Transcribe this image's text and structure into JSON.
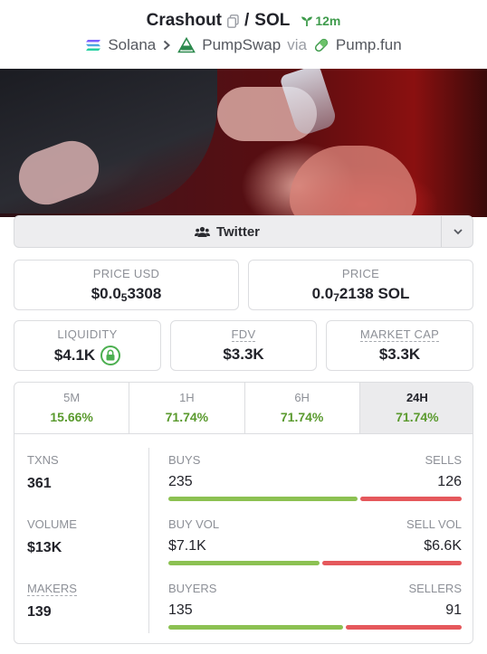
{
  "header": {
    "token": "Crashout",
    "separator": "/",
    "quote": "SOL",
    "age": "12m",
    "chain": "Solana",
    "dex": "PumpSwap",
    "via": "via",
    "launchpad": "Pump.fun"
  },
  "social": {
    "label": "Twitter"
  },
  "price_usd": {
    "label": "PRICE USD",
    "prefix": "$0.0",
    "zeros": "5",
    "rest": "3308"
  },
  "price": {
    "label": "PRICE",
    "prefix": "0.0",
    "zeros": "7",
    "rest": "2138 SOL"
  },
  "liquidity": {
    "label": "LIQUIDITY",
    "value": "$4.1K"
  },
  "fdv": {
    "label": "FDV",
    "value": "$3.3K"
  },
  "market_cap": {
    "label": "MARKET CAP",
    "value": "$3.3K"
  },
  "tabs": [
    {
      "label": "5M",
      "value": "15.66%"
    },
    {
      "label": "1H",
      "value": "71.74%"
    },
    {
      "label": "6H",
      "value": "71.74%"
    },
    {
      "label": "24H",
      "value": "71.74%"
    }
  ],
  "txns": {
    "label": "TXNS",
    "value": "361",
    "left_label": "BUYS",
    "right_label": "SELLS",
    "left": "235",
    "right": "126",
    "left_ratio": 0.65
  },
  "volume": {
    "label": "VOLUME",
    "value": "$13K",
    "left_label": "BUY VOL",
    "right_label": "SELL VOL",
    "left": "$7.1K",
    "right": "$6.6K",
    "left_ratio": 0.52
  },
  "makers": {
    "label": "MAKERS",
    "value": "139",
    "left_label": "BUYERS",
    "right_label": "SELLERS",
    "left": "135",
    "right": "91",
    "left_ratio": 0.6
  },
  "colors": {
    "positive": "#5a9a2e",
    "buy_bar": "#8cc152",
    "sell_bar": "#e5585c",
    "accent_green": "#3f9b4c"
  }
}
